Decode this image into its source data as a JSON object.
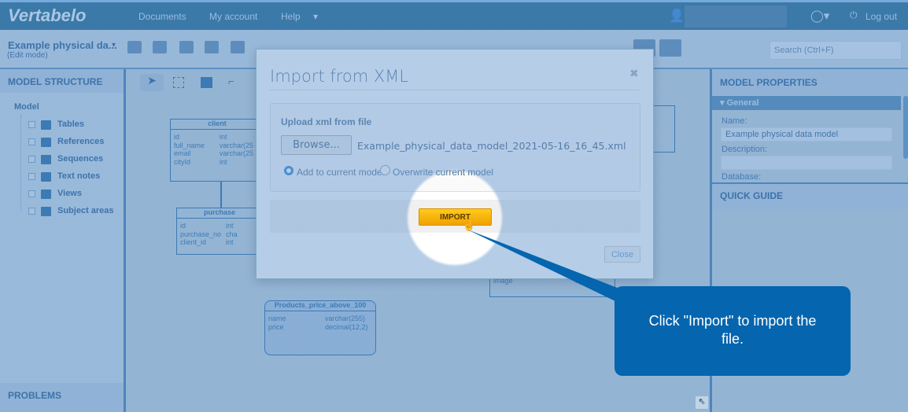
{
  "header": {
    "logo": "Vertabelo",
    "nav": [
      "Documents",
      "My account",
      "Help"
    ],
    "logout": "Log out"
  },
  "toolbar": {
    "model_title": "Example physical da...",
    "mode": "(Edit mode)",
    "search_placeholder": "Search (Ctrl+F)"
  },
  "left_panel": {
    "title": "MODEL STRUCTURE",
    "root": "Model",
    "items": [
      "Tables",
      "References",
      "Sequences",
      "Text notes",
      "Views",
      "Subject areas"
    ],
    "problems": "PROBLEMS"
  },
  "canvas": {
    "tables": [
      {
        "name": "client",
        "rows": [
          [
            "id",
            "int"
          ],
          [
            "full_name",
            "varchar(25"
          ],
          [
            "email",
            "varchar(25"
          ],
          [
            "cityId",
            "int"
          ]
        ]
      },
      {
        "name": "purchase",
        "rows": [
          [
            "id",
            "int"
          ],
          [
            "purchase_no",
            "cha"
          ],
          [
            "client_id",
            "int"
          ]
        ]
      },
      {
        "name": "Products_price_above_100",
        "rows": [
          [
            "name",
            "varchar(255)"
          ],
          [
            "price",
            "decimal(12,2)"
          ]
        ]
      },
      {
        "rows": [
          [
            "image",
            "byt"
          ]
        ]
      }
    ]
  },
  "right_panel": {
    "title": "MODEL PROPERTIES",
    "section": "General",
    "name_label": "Name:",
    "name_value": "Example physical data model",
    "description_label": "Description:",
    "database_label": "Database:",
    "quick_guide": "QUICK GUIDE"
  },
  "dialog": {
    "title": "Import from XML",
    "upload_label": "Upload xml from file",
    "browse": "Browse...",
    "filename": "Example_physical_data_model_2021-05-16_16_45.xml",
    "option_add": "Add to current model",
    "option_overwrite": "Overwrite current model",
    "import": "IMPORT",
    "close": "Close"
  },
  "callout": {
    "text": "Click \"Import\" to import the file."
  },
  "colors": {
    "callout": "#0565ae",
    "import_button": "#f5a800",
    "accent": "#09577f"
  }
}
